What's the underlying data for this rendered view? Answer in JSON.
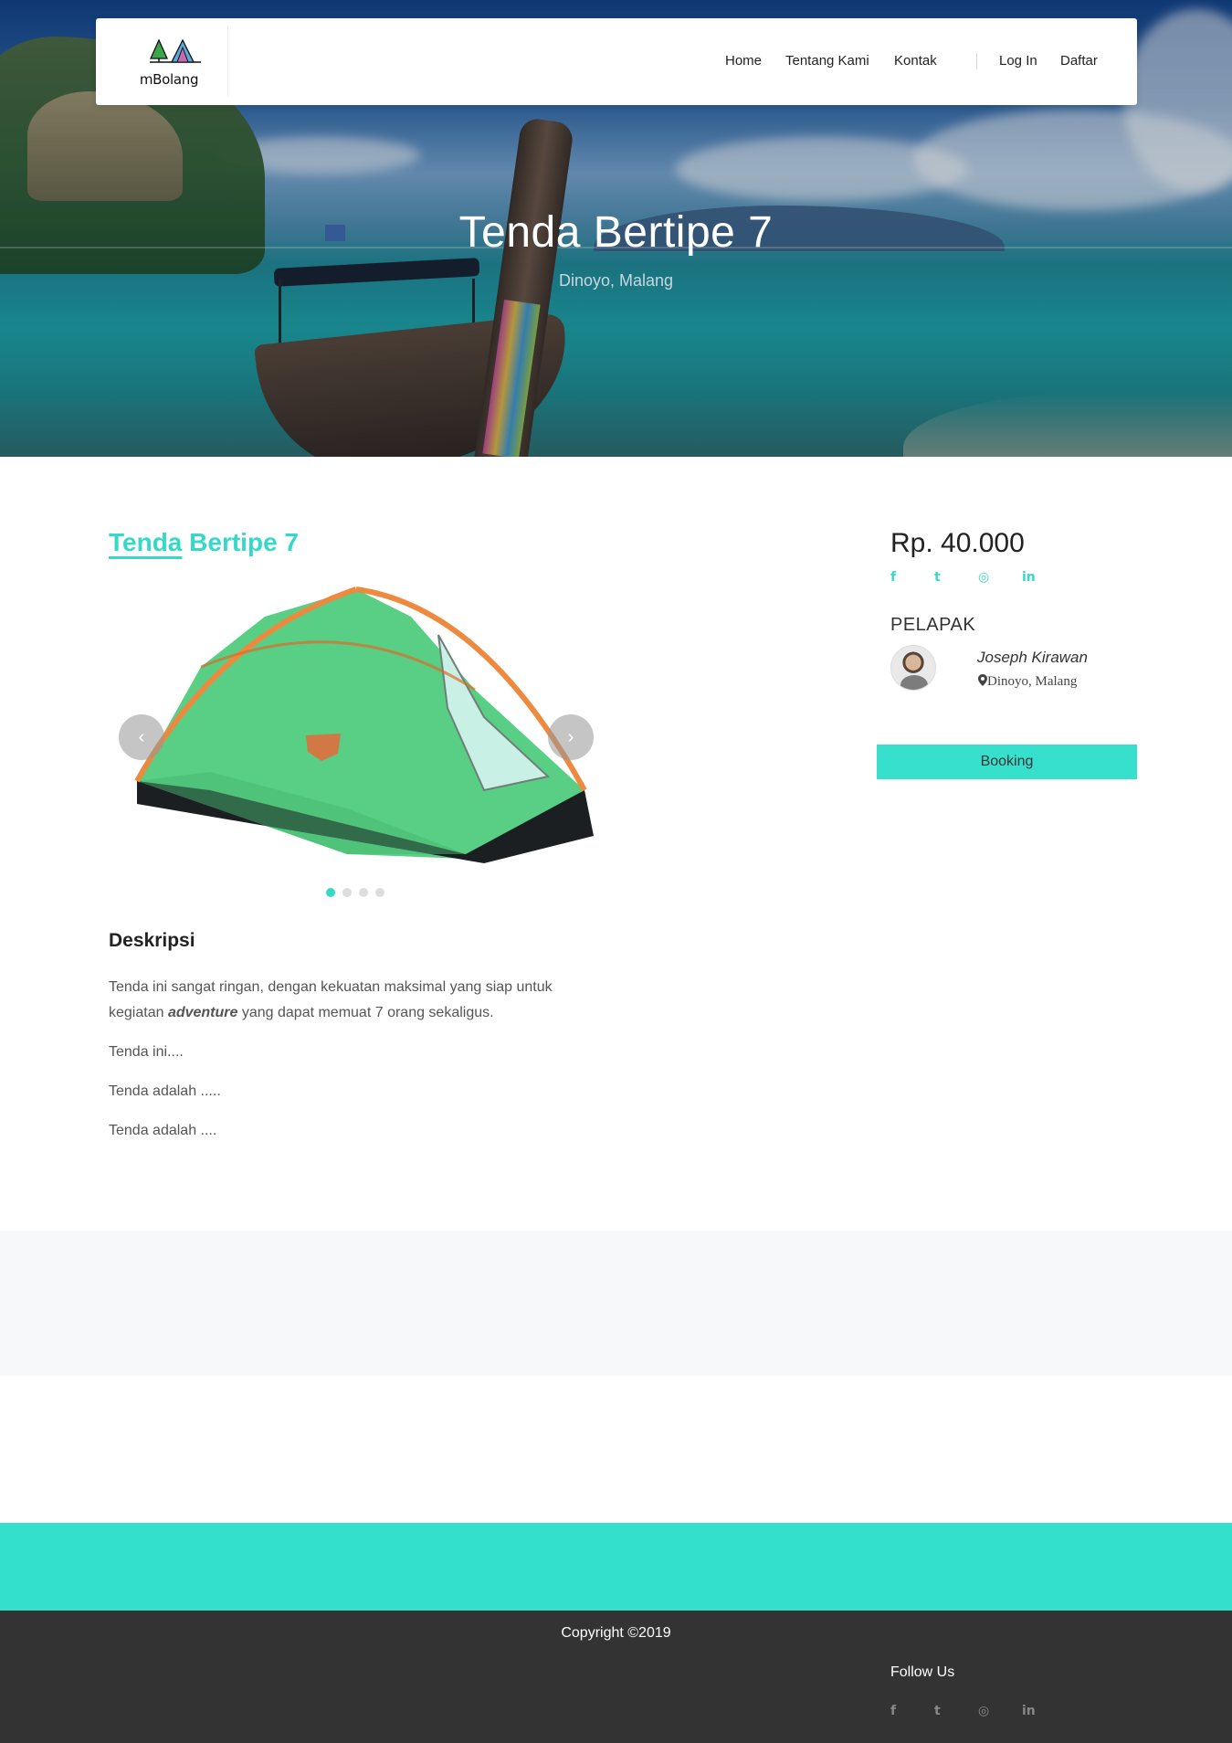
{
  "brand": {
    "name": "mBolang"
  },
  "nav": {
    "links": [
      "Home",
      "Tentang Kami",
      "Kontak"
    ],
    "login": "Log In",
    "register": "Daftar"
  },
  "hero": {
    "title": "Tenda Bertipe 7",
    "subtitle": "Dinoyo, Malang"
  },
  "product": {
    "title_word1": "Tenda",
    "title_rest": " Bertipe 7",
    "price": "Rp. 40.000",
    "carousel": {
      "prev_icon": "chevron-left-icon",
      "next_icon": "chevron-right-icon",
      "slide_count": 4,
      "active_slide": 1
    }
  },
  "social_icons": [
    "facebook-icon",
    "twitter-icon",
    "instagram-icon",
    "linkedin-icon"
  ],
  "social_glyphs": {
    "facebook": "f",
    "twitter": "t",
    "instagram": "◎",
    "linkedin": "in"
  },
  "seller": {
    "label": "PELAPAK",
    "name": "Joseph Kirawan",
    "location": "Dinoyo,  Malang"
  },
  "booking": {
    "label": "Booking"
  },
  "description": {
    "heading": "Deskripsi",
    "para1_part1": "Tenda ini sangat ringan, dengan kekuatan maksimal yang siap untuk kegiatan ",
    "para1_em": "adventure",
    "para1_part2": " yang dapat memuat 7 orang sekaligus.",
    "para2": "Tenda ini....",
    "para3": "Tenda adalah .....",
    "para4": "Tenda adalah ...."
  },
  "footer": {
    "copyright": "Copyright ©2019",
    "follow": "Follow Us"
  },
  "colors": {
    "accent": "#36d9c7",
    "band": "#33e0cb",
    "footer": "#333333"
  }
}
